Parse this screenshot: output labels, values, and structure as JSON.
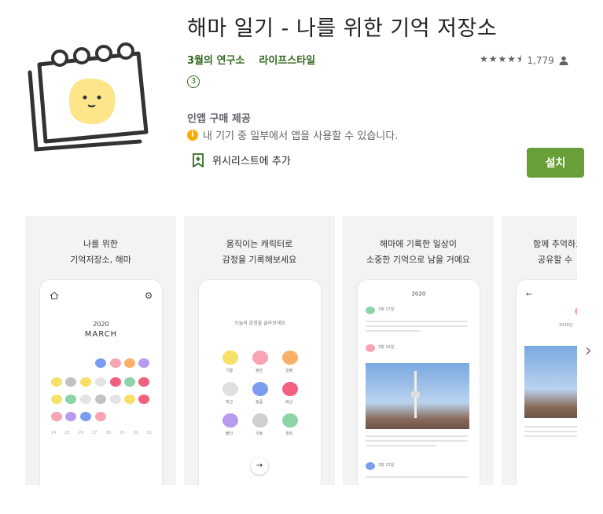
{
  "app": {
    "title": "해마 일기 - 나를 위한 기억 저장소",
    "developer": "3월의 연구소",
    "category": "라이프스타일",
    "rating_stars": "★★★★⯨",
    "rating_value": 4.5,
    "review_count": "1,779",
    "age_rating": "3",
    "in_app_purchase": "인앱 구매 제공",
    "compatibility": "내 기기 중 일부에서 앱을 사용할 수 있습니다.",
    "wishlist_label": "위시리스트에 추가",
    "install_label": "설치"
  },
  "icons": {
    "app_icon": "sticky-note-smiley-icon",
    "user": "person-icon",
    "info": "info-icon",
    "wishlist": "bookmark-plus-icon",
    "next": "chevron-right-icon"
  },
  "colors": {
    "brand_green": "#01875f",
    "install_button": "#689f38",
    "info_orange": "#f9ab00"
  },
  "screenshots": [
    {
      "caption_line1": "나를 위한",
      "caption_line2": "기억저장소, 해마",
      "year": "2020",
      "month": "MARCH",
      "calendar_numbers": [
        "24",
        "25",
        "26",
        "27",
        "28",
        "29",
        "30",
        "31"
      ]
    },
    {
      "caption_line1": "움직이는 캐릭터로",
      "caption_line2": "감정을 기록해보세요",
      "prompt": "오늘의 감정을 골라보세요",
      "emotions": [
        "기쁨",
        "평온",
        "설렘",
        "피곤",
        "슬픔",
        "화남",
        "불안",
        "우울",
        "행복"
      ]
    },
    {
      "caption_line1": "해마에 기록한 일상이",
      "caption_line2": "소중한 기억으로 남을 거예요",
      "year": "2020",
      "entry1_date": "3월 17일",
      "entry2_date": "3월 16일",
      "entry3_date": "3월 13일"
    },
    {
      "caption_line1": "함께 추억하고",
      "caption_line2": "공유할 수",
      "year": "2020년"
    }
  ]
}
